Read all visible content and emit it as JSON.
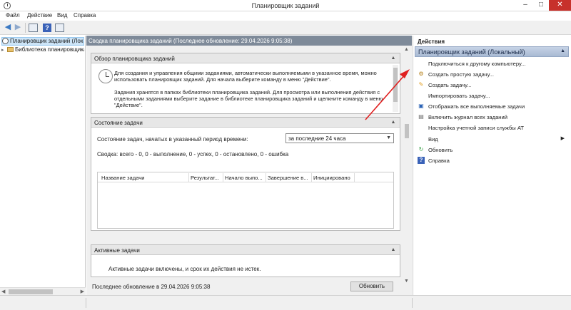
{
  "window": {
    "title": "Планировщик заданий"
  },
  "menu": [
    "Файл",
    "Действие",
    "Вид",
    "Справка"
  ],
  "tree": {
    "root": "Планировщик заданий (Локальный)",
    "library": "Библиотека планировщика заданий"
  },
  "center": {
    "header": "Сводка планировщика заданий (Последнее обновление: 29.04.2026 9:05:38)",
    "overview": {
      "title": "Обзор планировщика заданий",
      "para1": "Для создания и управления общими заданиями, автоматически выполняемыми в указанное время, можно использовать планировщик заданий. Для начала выберите команду в меню \"Действие\".",
      "para2": "Задания хранятся в папках библиотеки планировщика заданий. Для просмотра или выполнения действия с отдельными заданиями выберите задание в библиотеке планировщика заданий и щелкните команду в меню \"Действие\"."
    },
    "status": {
      "title": "Состояние задачи",
      "period_label": "Состояние задач, начатых в указанный период времени:",
      "period_value": "за последние 24 часа",
      "summary": "Сводка: всего - 0, 0 - выполнение, 0 - успех, 0 - остановлено, 0 - ошибка",
      "columns": [
        "Название задачи",
        "Результат...",
        "Начало выпо...",
        "Завершение в...",
        "Инициировано"
      ]
    },
    "active": {
      "title": "Активные задачи",
      "text": "Активные задачи включены, и срок их действия не истек."
    },
    "footer": {
      "last_update": "Последнее обновление в 29.04.2026 9:05:38",
      "refresh_button": "Обновить"
    }
  },
  "actions": {
    "title": "Действия",
    "group": "Планировщик заданий (Локальный)",
    "items": [
      "Подключиться к другому компьютеру...",
      "Создать простую задачу...",
      "Создать задачу...",
      "Импортировать задачу...",
      "Отображать все выполняемые задачи",
      "Включить журнал всех заданий",
      "Настройка учетной записи службы AT",
      "Вид",
      "Обновить",
      "Справка"
    ]
  }
}
